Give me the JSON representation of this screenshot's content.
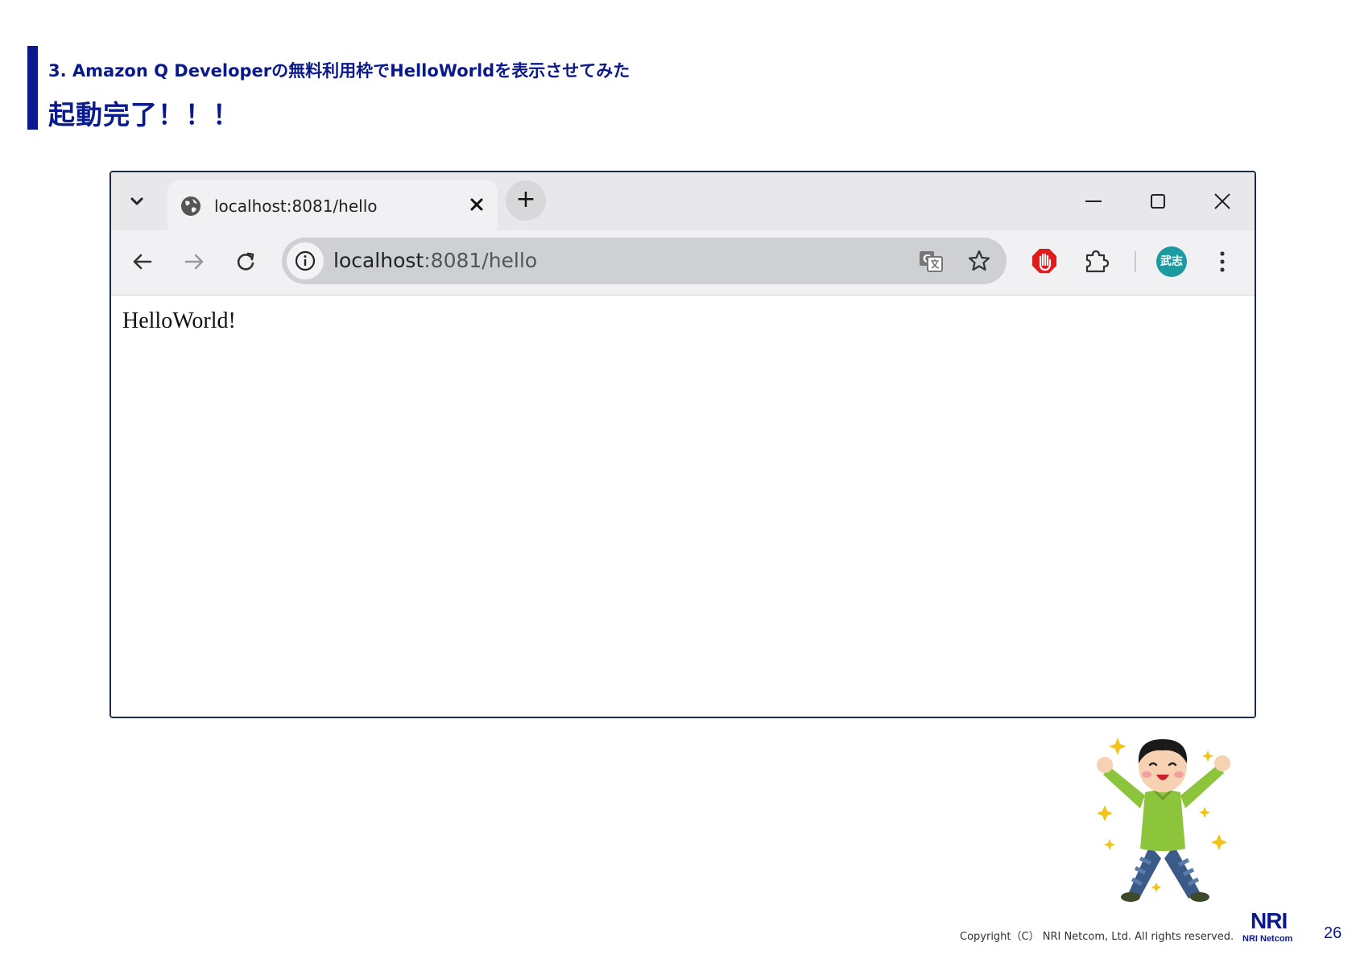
{
  "slide": {
    "subtitle": "3. Amazon Q Developerの無料利用枠でHelloWorldを表示させてみた",
    "title": "起動完了！！！",
    "copyright": "Copyright（C） NRI Netcom, Ltd. All rights reserved.",
    "logo_mark": "NRI",
    "logo_name": "NRI Netcom",
    "page_number": "26",
    "accent_color": "#0a1a8c"
  },
  "browser": {
    "tab": {
      "title": "localhost:8081/hello",
      "icon": "globe-icon"
    },
    "tab_menu_icon": "chevron-down-icon",
    "new_tab_label": "+",
    "window_controls": [
      "minimize-icon",
      "maximize-icon",
      "close-icon"
    ],
    "toolbar": {
      "back_icon": "back-arrow-icon",
      "forward_icon": "forward-arrow-icon",
      "reload_icon": "reload-icon",
      "url_host": "localhost",
      "url_rest": ":8081/hello",
      "translate_icon": "translate-icon",
      "bookmark_icon": "star-icon",
      "extension_icons": [
        "stop-hand-icon",
        "puzzle-icon"
      ],
      "avatar_text": "武志",
      "avatar_color": "#1c9aa0",
      "menu_icon": "kebab-menu-icon"
    },
    "content": {
      "text": "HelloWorld!"
    }
  }
}
